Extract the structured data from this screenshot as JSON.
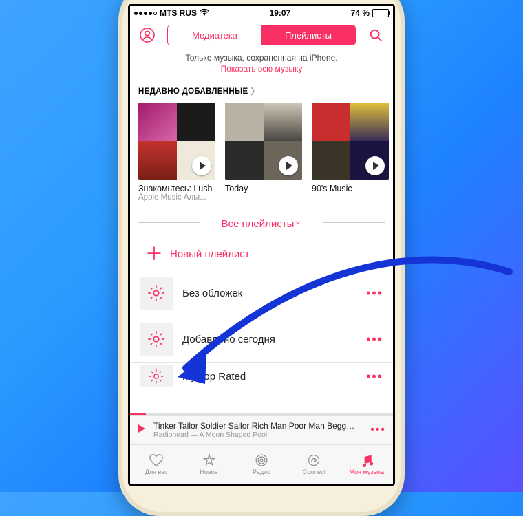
{
  "status": {
    "carrier": "MTS RUS",
    "time": "19:07",
    "battery_text": "74 %"
  },
  "nav": {
    "tab_library": "Медиатека",
    "tab_playlists": "Плейлисты"
  },
  "banner": {
    "line1": "Только музыка, сохраненная на iPhone.",
    "link": "Показать всю музыку"
  },
  "recent": {
    "header": "НЕДАВНО ДОБАВЛЕННЫЕ",
    "items": [
      {
        "title": "Знакомьтесь: Lush",
        "subtitle": "Apple Music Альт..."
      },
      {
        "title": "Today",
        "subtitle": ""
      },
      {
        "title": "90's Music",
        "subtitle": ""
      }
    ]
  },
  "filter_label": "Все плейлисты",
  "new_playlist_label": "Новый плейлист",
  "playlists": [
    {
      "name": "Без обложек"
    },
    {
      "name": "Добавлено сегодня"
    },
    {
      "name": "My Top Rated"
    }
  ],
  "now_playing": {
    "title": "Tinker Tailor Soldier Sailor Rich Man Poor Man Begg…",
    "subtitle": "Radiohead — A Moon Shaped Pool"
  },
  "tabs": {
    "for_you": "Для вас",
    "new": "Новое",
    "radio": "Радио",
    "connect": "Connect",
    "my_music": "Моя музыка"
  },
  "colors": {
    "accent": "#fa2f63"
  }
}
